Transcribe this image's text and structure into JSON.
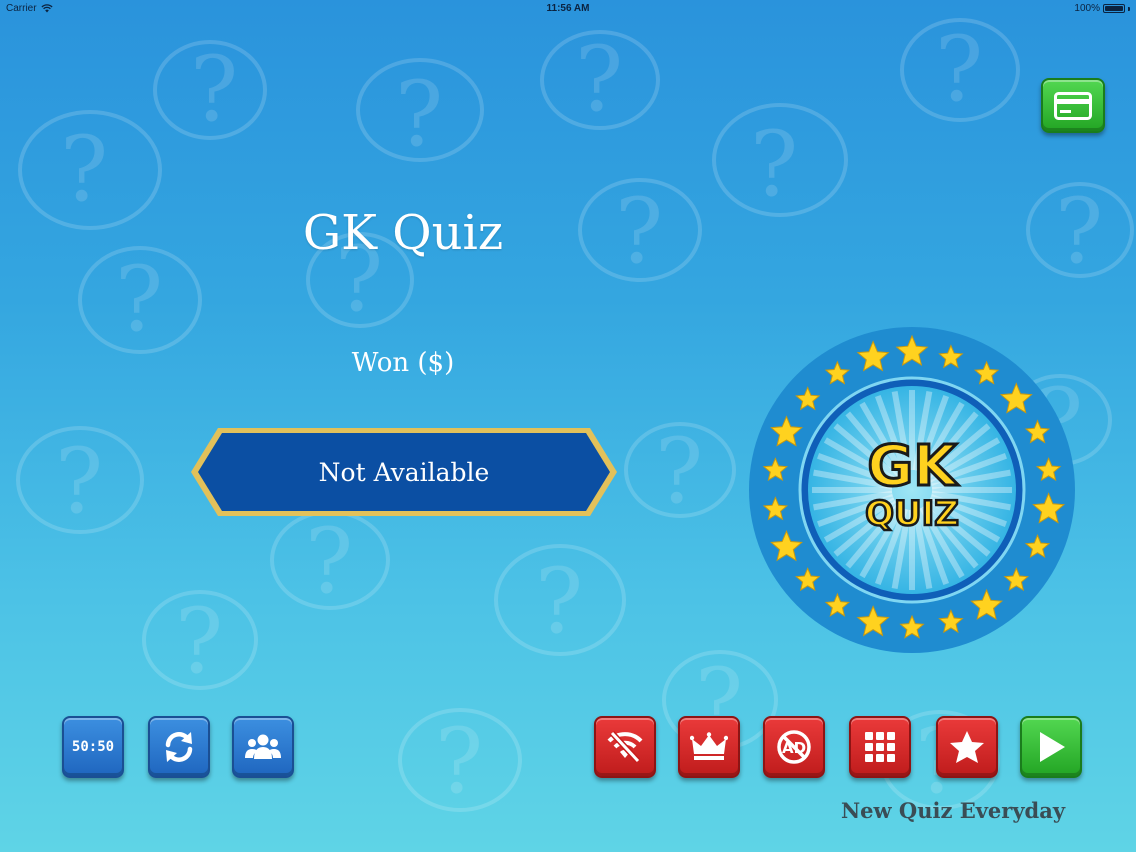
{
  "status_bar": {
    "carrier": "Carrier",
    "time": "11:56 AM",
    "battery_percent": "100%"
  },
  "main": {
    "title": "GK Quiz",
    "won_label": "Won ($)",
    "banner_text": "Not Available"
  },
  "emblem": {
    "line1": "GK",
    "line2": "QUIZ"
  },
  "buttons": {
    "fifty_fifty": "50:50"
  },
  "footer": {
    "tagline": "New Quiz Everyday"
  },
  "icons": {
    "payment": "credit-card-icon",
    "fifty_fifty": "fifty-fifty-icon",
    "refresh": "refresh-icon",
    "multiplayer": "group-icon",
    "no_wifi": "no-wifi-icon",
    "leaderboard": "crown-icon",
    "remove_ads": "no-ads-icon",
    "more_apps": "grid-icon",
    "rate": "star-icon",
    "play": "play-icon"
  },
  "colors": {
    "background_top": "#2a93dc",
    "background_bottom": "#5fd4e6",
    "banner_fill": "#0b4fa3",
    "banner_border": "#e2c15a",
    "button_blue": "#1f66bf",
    "button_red": "#bf1c1c",
    "button_green": "#23a524",
    "star_gold": "#ffd21f"
  }
}
